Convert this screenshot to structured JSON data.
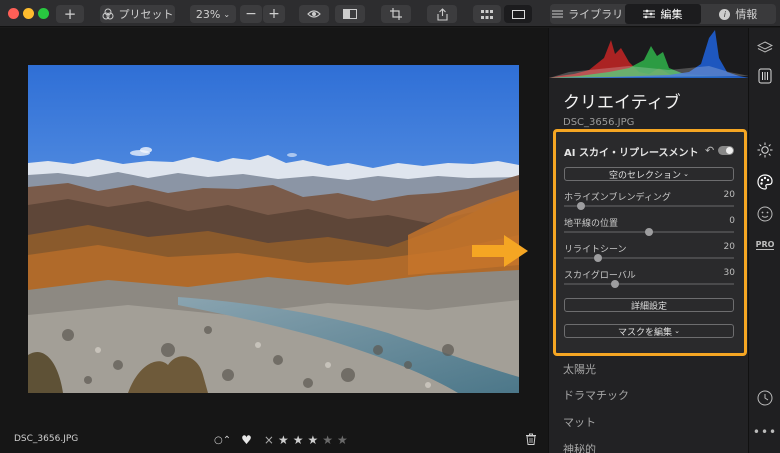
{
  "toolbar": {
    "preset_label": "プリセット",
    "zoom_label": "23%",
    "library_label": "ライブラリ",
    "edit_label": "編集",
    "info_label": "情報"
  },
  "canvas": {
    "filename": "DSC_3656.JPG",
    "rating": 3,
    "rating_max": 5
  },
  "panel": {
    "title": "クリエイティブ",
    "filename": "DSC_3656.JPG",
    "module": {
      "title": "AI スカイ・リプレースメント",
      "sky_selection": "空のセレクション",
      "sliders": [
        {
          "label": "ホライズンブレンディング",
          "value": "20",
          "level": 0.1
        },
        {
          "label": "地平線の位置",
          "value": "0",
          "level": 0.5
        },
        {
          "label": "リライトシーン",
          "value": "20",
          "level": 0.2
        },
        {
          "label": "スカイグローバル",
          "value": "30",
          "level": 0.3
        }
      ],
      "advanced_label": "詳細設定",
      "edit_mask_label": "マスクを編集"
    },
    "tools": [
      "太陽光",
      "ドラマチック",
      "マット",
      "神秘的"
    ]
  },
  "colors": {
    "highlight": "#f5a623",
    "accent_arrow": "#f5a623"
  }
}
